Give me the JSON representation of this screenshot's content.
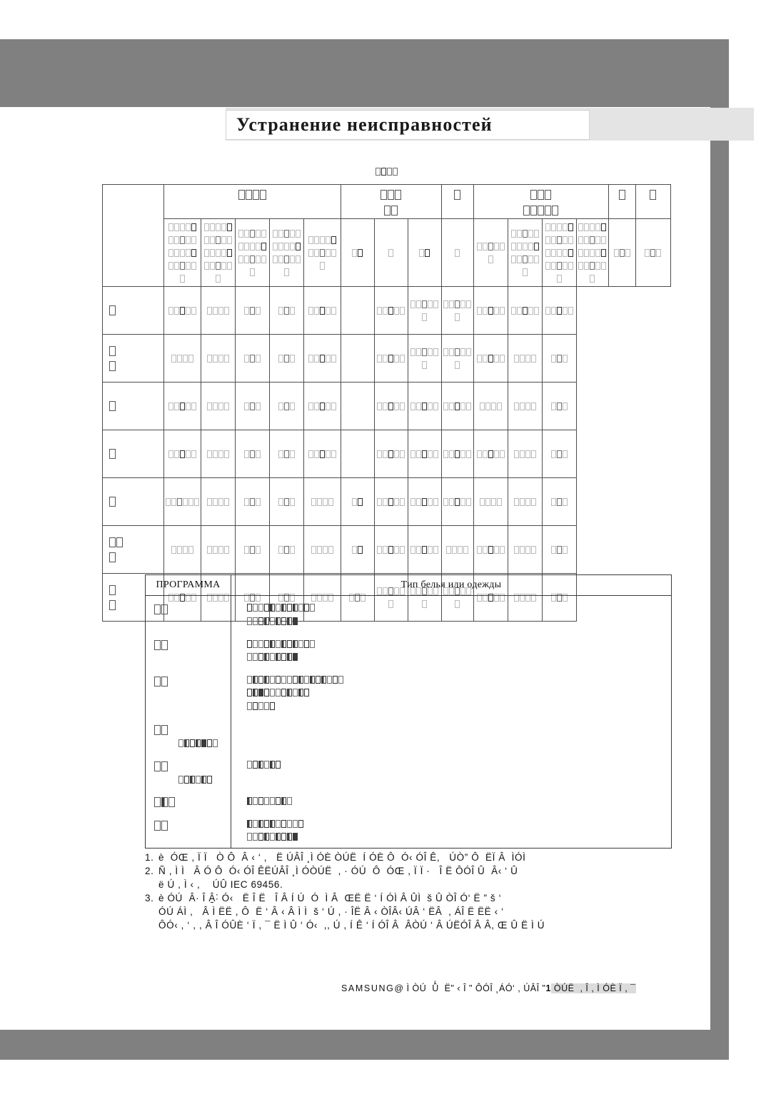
{
  "page": {
    "title": "Устранение неисправностей",
    "frame_color": "#808080",
    "title_band_color": "#e4e4e4",
    "note": "Text in tables rendered as missing-glyph boxes; footnotes rendered as mojibake."
  },
  "main_table": {
    "top_caption_glyphs": 4,
    "header_top": [
      {
        "name": "col-spec-row-label",
        "glyphs": 0,
        "span": 1
      },
      {
        "name": "col-group-a",
        "glyphs": 4,
        "span": 5
      },
      {
        "name": "col-group-b",
        "glyphs": 3,
        "span": 3,
        "sub_glyphs": 2
      },
      {
        "name": "col-group-c",
        "glyphs": 1,
        "span": 1
      },
      {
        "name": "col-group-d",
        "glyphs": 3,
        "span": 4,
        "sub_glyphs": 5
      },
      {
        "name": "col-group-e",
        "glyphs": 1,
        "span": 1
      },
      {
        "name": "col-group-f",
        "glyphs": 1,
        "span": 1
      }
    ],
    "header_sub": [
      {
        "glyphs": 2
      },
      {
        "glyphs": 21
      },
      {
        "glyphs": 21
      },
      {
        "glyphs": 16
      },
      {
        "glyphs": 16
      },
      {
        "glyphs": 11
      },
      {
        "glyphs": 2
      },
      {
        "glyphs": 1
      },
      {
        "glyphs": 2
      },
      {
        "glyphs": 1
      },
      {
        "glyphs": 6
      },
      {
        "glyphs": 16
      },
      {
        "glyphs": 21
      },
      {
        "glyphs": 21
      },
      {
        "glyphs": 3
      },
      {
        "glyphs": 3
      }
    ],
    "rows": [
      {
        "label_glyphs": 1,
        "label_lines": 1,
        "cells": [
          5,
          4,
          3,
          3,
          5,
          0,
          5,
          6,
          6,
          5,
          5,
          5
        ]
      },
      {
        "label_glyphs": 1,
        "label_lines": 2,
        "cells": [
          4,
          4,
          3,
          3,
          5,
          0,
          5,
          6,
          6,
          5,
          4,
          3
        ]
      },
      {
        "label_glyphs": 1,
        "label_lines": 1,
        "cells": [
          5,
          4,
          3,
          3,
          5,
          0,
          5,
          5,
          5,
          4,
          4,
          3
        ]
      },
      {
        "label_glyphs": 1,
        "label_lines": 1,
        "cells": [
          5,
          4,
          3,
          3,
          5,
          0,
          5,
          5,
          5,
          5,
          4,
          3
        ]
      },
      {
        "label_glyphs": 1,
        "label_lines": 1,
        "cells": [
          6,
          4,
          3,
          3,
          4,
          2,
          5,
          5,
          5,
          4,
          4,
          3
        ]
      },
      {
        "label_glyphs": 2,
        "label_lines": 2,
        "cells": [
          4,
          4,
          3,
          3,
          4,
          2,
          5,
          5,
          4,
          5,
          4,
          3
        ]
      },
      {
        "label_glyphs": 1,
        "label_lines": 2,
        "cells": [
          5,
          4,
          3,
          3,
          4,
          3,
          6,
          6,
          6,
          5,
          4,
          3
        ]
      }
    ]
  },
  "programs_table": {
    "header": {
      "col1": "ПРОГРАММА",
      "col2": "Тип белья или одежды"
    },
    "rows": [
      {
        "code_glyphs": 2,
        "code_extra": 0,
        "desc_lines": [
          12,
          9
        ]
      },
      {
        "code_glyphs": 2,
        "code_extra": 0,
        "desc_lines": [
          12,
          9
        ]
      },
      {
        "code_glyphs": 2,
        "code_extra": 0,
        "desc_lines": [
          17,
          11,
          5
        ]
      },
      {
        "code_glyphs": 2,
        "code_extra": 7,
        "desc_lines": []
      },
      {
        "code_glyphs": 2,
        "code_extra": 6,
        "desc_lines": [
          6
        ]
      },
      {
        "code_glyphs": 3,
        "code_extra": 0,
        "desc_lines": [
          8
        ]
      },
      {
        "code_glyphs": 2,
        "code_extra": 0,
        "desc_lines": [
          10,
          9
        ]
      }
    ]
  },
  "footnotes": [
    {
      "number": "1.",
      "lines": [
        "è  ÓŒ , Ï Ï   Ò Ô  Â ‹ ‘ ,   Ë ÚÂÎ ¸Ì ÓÈ ÒÚË  Í ÓÈ Ô  Ó‹ ÓÎ Ê,   ÚÒ” Ô  ËÏ Â  ÌÓÌ"
      ]
    },
    {
      "number": "2.",
      "lines": [
        "Ñ , Ì Ì   Â Ó Ô  Ó‹ ÓÎ ÊËÚÂÎ ¸Ì ÓÒÚË  , · ÓÚ  Ô  ÓŒ , Ï Ï ·   Î Ë ÔÓÎ Û  Â‹ ‘ Û",
        "ë Ú , Ì ‹ ,    ÚÛ IEC 69456."
      ]
    },
    {
      "number": "3.",
      "lines": [
        "è ÓÚ  Â· Î Â̠˸ Ó‹   Ë Î Ë   Î Â Í Ú  Ó  Ì Â  ŒË Ë ‘ Í ÓÌ Â ÛÌ  š Û ÒÎ Ó‘ Ë ” š ‘",
        "ÓÚ ÁÌ ,   Â Ì ËË , Ô  Ë ‘ Â ‹ Â Ì Ì  š ‘ Ú , · ÎË Â ‹ ÒÎÂ‹ ÚÂ ‘ ËÂ  , ÁÎ Ë ËË ‹ ‘",
        "ÔÓ‹ , ‘ , , Â Î ÓÛÈ ‘ Ï , ¯ Ë Ì Û ‘ Ó‹  ,, Ú , Í Ê ‘ Í ÓÎ Â  ÂÒÚ ‘ Â ÚËÓÎ Â Â, Œ Û Ë Ì Ú"
      ]
    }
  ],
  "footer": {
    "brand": "SAMSUNG",
    "segments": [
      {
        "text": "@ Ì ÒÚ  Ûͬ  Ë\" ‹ Î \" ÔÓÎ ¸ÁÓ‘ , ÚÂÎ \"",
        "style": "plain"
      },
      {
        "text": "1",
        "style": "bold"
      },
      {
        "text": " ÒÚË  , Î , Ì ÓÈ Ï , ¯",
        "style": "grey"
      }
    ]
  }
}
